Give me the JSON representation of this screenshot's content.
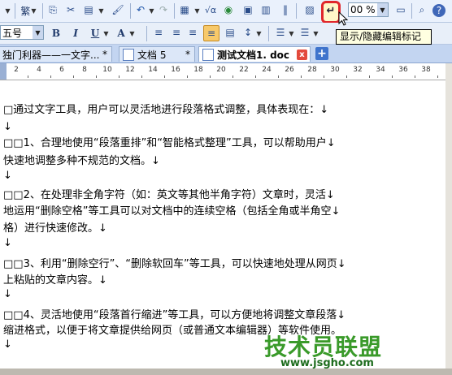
{
  "toolbar1": {
    "traditional_label": "繁",
    "zoom_value": "00 %",
    "highlighted_button_icon": "show-hide-formatting-marks-icon",
    "tooltip": "显示/隐藏编辑标记"
  },
  "toolbar2": {
    "font_size_value": "五号",
    "bold_label": "B",
    "italic_label": "I",
    "underline_label": "U",
    "font_color_label": "A"
  },
  "tabs": [
    {
      "label": "独门利器——一文字...",
      "marker": "*"
    },
    {
      "label": "文档 5",
      "marker": "*"
    },
    {
      "label": "测试文档1. doc",
      "marker": "x"
    }
  ],
  "add_tab_label": "+",
  "ruler": {
    "numbers": [
      "2",
      "4",
      "6",
      "8",
      "10",
      "12",
      "14",
      "16",
      "18",
      "20",
      "22",
      "24",
      "26",
      "28",
      "30",
      "32",
      "34",
      "36",
      "38"
    ]
  },
  "document": {
    "lines": [
      "□通过文字工具，用户可以灵活地进行段落格式调整，具体表现在：↓",
      "↓",
      "□□1、合理地使用“段落重排”和“智能格式整理”工具，可以帮助用户↓",
      "快速地调整多种不规范的文档。↓",
      "↓",
      "□□2、在处理非全角字符（如：英文等其他半角字符）文章时，灵活↓",
      "地运用“删除空格”等工具可以对文档中的连续空格（包括全角或半角空↓",
      "格）进行快速修改。↓",
      "↓",
      "□□3、利用“删除空行”、“删除软回车”等工具，可以快速地处理从网页↓",
      "上粘贴的文章内容。↓",
      "↓",
      "□□4、灵活地使用“段落首行缩进”等工具，可以方便地将调整文章段落↓",
      "缩进格式，以便于将文章提供给网页（或普通文本编辑器）等软件使用。",
      "↓"
    ]
  },
  "watermark": {
    "title": "技术员联盟",
    "url": "www.jsgho.com"
  },
  "colors": {
    "highlight_border": "#e0262b",
    "watermark_green": "#3a9a2a"
  }
}
